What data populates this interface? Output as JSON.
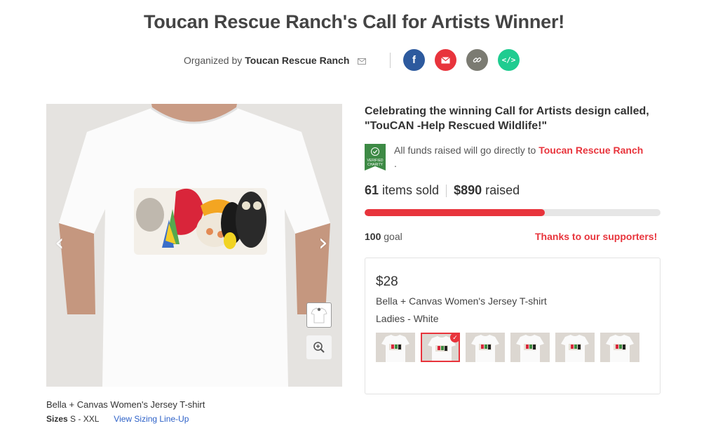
{
  "header": {
    "title": "Toucan Rescue Ranch's Call for Artists Winner!",
    "organized_by_label": "Organized by",
    "organizer": "Toucan Rescue Ranch"
  },
  "share": {
    "icons": [
      "facebook-icon",
      "email-icon",
      "link-icon",
      "embed-code-icon"
    ],
    "colors": {
      "facebook": "#2d5a9e",
      "email": "#e8343c",
      "link": "#7b7b72",
      "embed": "#1fcc90"
    }
  },
  "product": {
    "name": "Bella + Canvas Women's Jersey T-shirt",
    "sizes_label": "Sizes",
    "sizes_value": "S - XXL",
    "sizing_link": "View Sizing Line-Up"
  },
  "campaign": {
    "headline": "Celebrating the winning Call for Artists design called, \"TouCAN -Help Rescued Wildlife!\"",
    "charity_text": "All funds raised will go directly to",
    "charity_name": "Toucan Rescue Ranch",
    "charity_suffix": ".",
    "badge_text": "VERIFIED CHARITY",
    "items_sold": "61",
    "items_sold_label": "items sold",
    "raised": "$890",
    "raised_label": "raised",
    "progress_fraction": 0.61,
    "goal": "100",
    "goal_label": "goal",
    "thanks_link": "Thanks to our supporters!"
  },
  "buy": {
    "price": "$28",
    "style": "Bella + Canvas Women's Jersey T-shirt",
    "color": "Ladies - White",
    "selected_index": 1,
    "swatch_count": 6
  },
  "accent": "#e8343c"
}
